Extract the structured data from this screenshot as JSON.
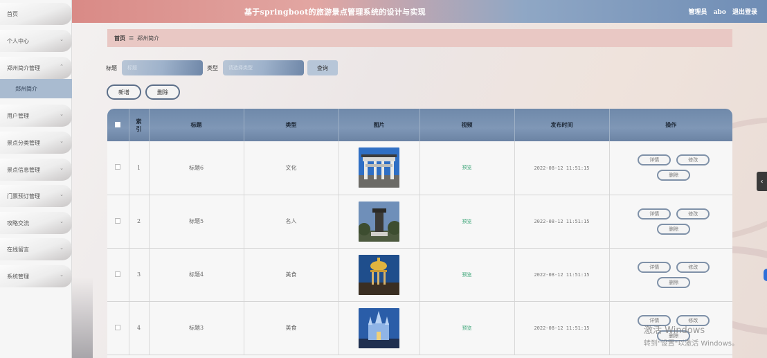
{
  "header": {
    "title": "基于springboot的旅游景点管理系统的设计与实现",
    "user_role": "管理员",
    "username": "abo",
    "logout": "退出登录",
    "gradient_colors": [
      "#d98a86",
      "#8fa7c5",
      "#6f8db5"
    ]
  },
  "sidebar": {
    "items": [
      {
        "label": "首页",
        "has_chevron": false
      },
      {
        "label": "个人中心",
        "has_chevron": true
      },
      {
        "label": "郑州简介管理",
        "has_chevron": true,
        "expanded": true
      },
      {
        "label": "用户管理",
        "has_chevron": true
      },
      {
        "label": "景点分类管理",
        "has_chevron": true
      },
      {
        "label": "景点信息管理",
        "has_chevron": true
      },
      {
        "label": "门票预订管理",
        "has_chevron": true
      },
      {
        "label": "攻略交流",
        "has_chevron": true
      },
      {
        "label": "在线留言",
        "has_chevron": true
      },
      {
        "label": "系统管理",
        "has_chevron": true
      }
    ],
    "active_sub": "郑州简介",
    "chevron_down": "⌄",
    "chevron_up": "⌃"
  },
  "breadcrumb": {
    "home": "首页",
    "separator": "☰",
    "current": "郑州简介"
  },
  "search": {
    "title_label": "标题",
    "title_placeholder": "标题",
    "type_label": "类型",
    "type_placeholder": "请选择类型",
    "search_button": "查询"
  },
  "actions": {
    "add": "新增",
    "delete": "删除"
  },
  "table": {
    "columns": [
      "",
      "索引",
      "标题",
      "类型",
      "图片",
      "视频",
      "发布时间",
      "操作"
    ],
    "rows": [
      {
        "index": "1",
        "title": "标题6",
        "type": "文化",
        "image": "archway-photo",
        "video": "预览",
        "time": "2022-08-12 11:51:15"
      },
      {
        "index": "2",
        "title": "标题5",
        "type": "名人",
        "image": "monument-photo",
        "video": "预览",
        "time": "2022-08-12 11:51:15"
      },
      {
        "index": "3",
        "title": "标题4",
        "type": "美食",
        "image": "pavilion-photo",
        "video": "预览",
        "time": "2022-08-12 11:51:15"
      },
      {
        "index": "4",
        "title": "标题3",
        "type": "美食",
        "image": "castle-photo",
        "video": "预览",
        "time": "2022-08-12 11:51:15"
      }
    ],
    "row_actions": {
      "view": "详情",
      "edit": "修改",
      "delete": "删除"
    }
  },
  "overlay": {
    "side_tab": "‹",
    "watermark_line1": "激活 Windows",
    "watermark_line2": "转到\"设置\"以激活 Windows。"
  },
  "colors": {
    "accent_blue": "#6f89aa",
    "breadcrumb_bg": "#e9c8c4",
    "preview_link": "#3aa476",
    "sidebar_active": "#a9bbd0"
  }
}
